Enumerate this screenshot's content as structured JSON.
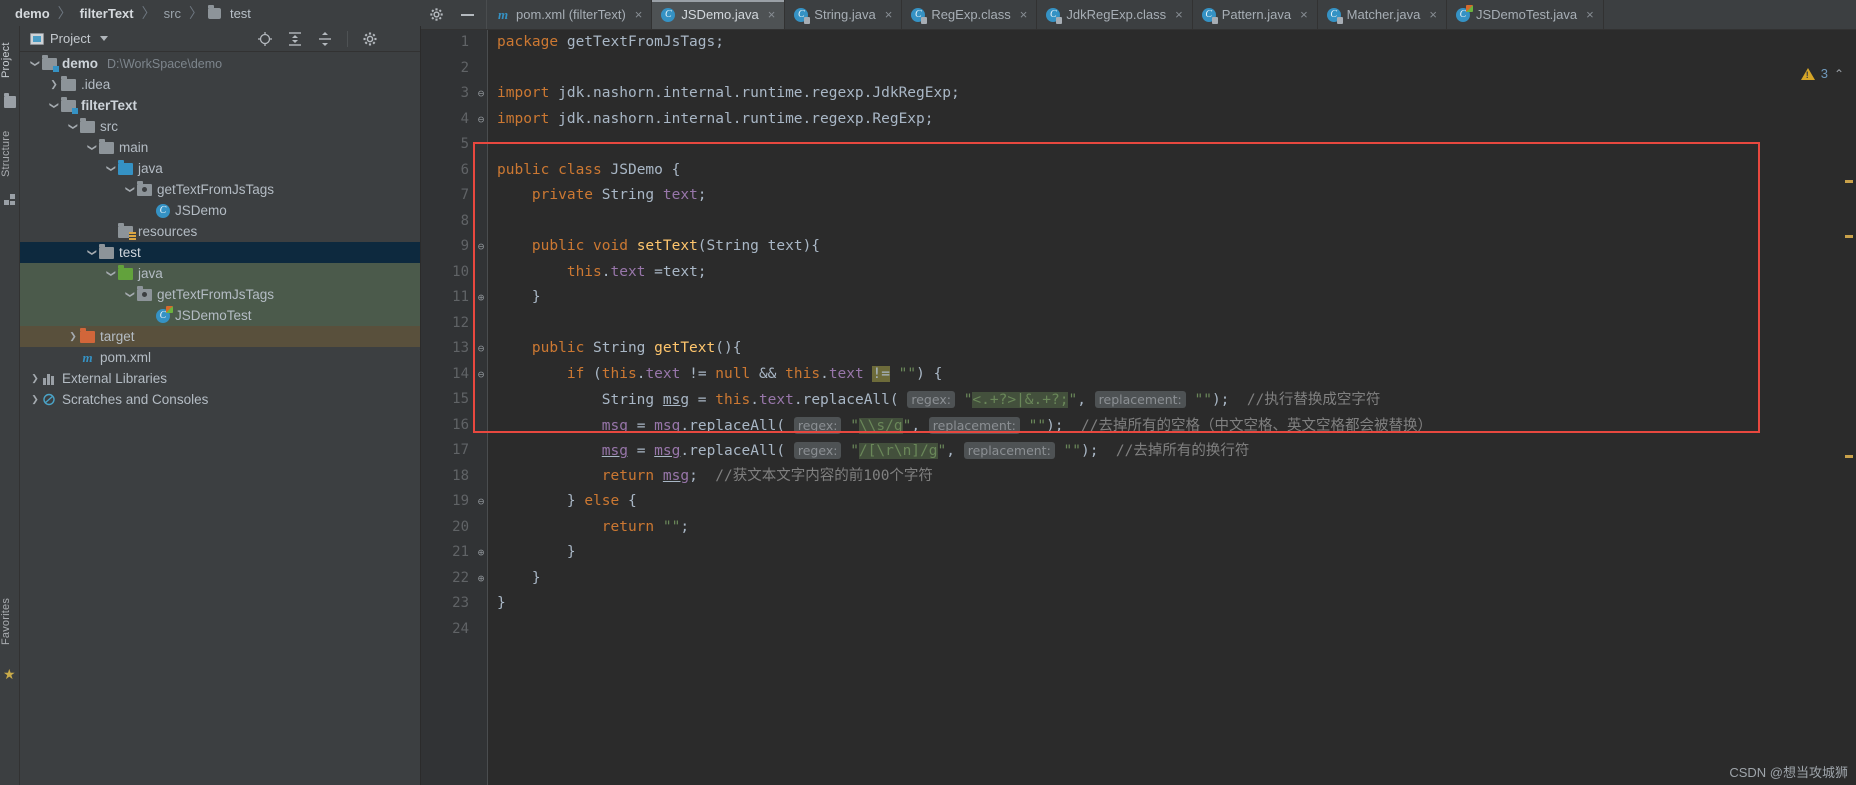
{
  "breadcrumb": {
    "items": [
      {
        "label": "demo",
        "style": "bold"
      },
      {
        "label": "filterText",
        "style": "bold"
      },
      {
        "label": "src",
        "style": "dim"
      },
      {
        "label": "test",
        "style": "folder"
      }
    ],
    "separator": "〉"
  },
  "left_strip": {
    "project_label": "Project",
    "structure_label": "Structure",
    "favorites_label": "Favorites"
  },
  "project_panel": {
    "title": "Project",
    "tools": [
      "locate-icon",
      "expand-all-icon",
      "collapse-all-icon",
      "settings-icon",
      "hide-icon"
    ],
    "tree": [
      {
        "indent": 0,
        "chev": "down",
        "icon": "module-folder",
        "label": "demo",
        "bold": true,
        "path": "D:\\WorkSpace\\demo",
        "bg": "none"
      },
      {
        "indent": 1,
        "chev": "right",
        "icon": "folder-grey",
        "label": ".idea",
        "bold": false,
        "path": "",
        "bg": "none"
      },
      {
        "indent": 1,
        "chev": "down",
        "icon": "module-folder",
        "label": "filterText",
        "bold": true,
        "path": "",
        "bg": "none"
      },
      {
        "indent": 2,
        "chev": "down",
        "icon": "folder-grey",
        "label": "src",
        "bold": false,
        "path": "",
        "bg": "none"
      },
      {
        "indent": 3,
        "chev": "down",
        "icon": "folder-grey",
        "label": "main",
        "bold": false,
        "path": "",
        "bg": "none"
      },
      {
        "indent": 4,
        "chev": "down",
        "icon": "folder-blue",
        "label": "java",
        "bold": false,
        "path": "",
        "bg": "none"
      },
      {
        "indent": 5,
        "chev": "down",
        "icon": "package",
        "label": "getTextFromJsTags",
        "bold": false,
        "path": "",
        "bg": "none"
      },
      {
        "indent": 6,
        "chev": "none",
        "icon": "class",
        "label": "JSDemo",
        "bold": false,
        "path": "",
        "bg": "none"
      },
      {
        "indent": 4,
        "chev": "none",
        "icon": "resources",
        "label": "resources",
        "bold": false,
        "path": "",
        "bg": "none"
      },
      {
        "indent": 3,
        "chev": "down",
        "icon": "folder-grey",
        "label": "test",
        "bold": false,
        "path": "",
        "bg": "selected"
      },
      {
        "indent": 4,
        "chev": "down",
        "icon": "folder-green",
        "label": "java",
        "bold": false,
        "path": "",
        "bg": "green"
      },
      {
        "indent": 5,
        "chev": "down",
        "icon": "package",
        "label": "getTextFromJsTags",
        "bold": false,
        "path": "",
        "bg": "green"
      },
      {
        "indent": 6,
        "chev": "none",
        "icon": "test-class",
        "label": "JSDemoTest",
        "bold": false,
        "path": "",
        "bg": "green"
      },
      {
        "indent": 2,
        "chev": "right",
        "icon": "folder-orange",
        "label": "target",
        "bold": false,
        "path": "",
        "bg": "brown"
      },
      {
        "indent": 2,
        "chev": "none",
        "icon": "maven",
        "label": "pom.xml",
        "bold": false,
        "path": "",
        "bg": "none"
      },
      {
        "indent": 0,
        "chev": "right",
        "icon": "library",
        "label": "External Libraries",
        "bold": false,
        "path": "",
        "bg": "none"
      },
      {
        "indent": 0,
        "chev": "right",
        "icon": "scratch",
        "label": "Scratches and Consoles",
        "bold": false,
        "path": "",
        "bg": "none"
      }
    ]
  },
  "editor": {
    "left_tools": [
      "settings-gear-icon",
      "hide-panel-icon"
    ],
    "tabs": [
      {
        "label": "pom.xml (filterText)",
        "icon": "maven-icon",
        "active": false,
        "closable": true
      },
      {
        "label": "JSDemo.java",
        "icon": "java-class-icon",
        "active": true,
        "closable": true
      },
      {
        "label": "String.java",
        "icon": "java-class-locked-icon",
        "active": false,
        "closable": true
      },
      {
        "label": "RegExp.class",
        "icon": "java-class-locked-icon",
        "active": false,
        "closable": true
      },
      {
        "label": "JdkRegExp.class",
        "icon": "java-class-locked-icon",
        "active": false,
        "closable": true
      },
      {
        "label": "Pattern.java",
        "icon": "java-class-locked-icon",
        "active": false,
        "closable": true
      },
      {
        "label": "Matcher.java",
        "icon": "java-class-locked-icon",
        "active": false,
        "closable": true
      },
      {
        "label": "JSDemoTest.java",
        "icon": "java-test-class-icon",
        "active": false,
        "closable": true
      }
    ],
    "inspection": {
      "warning_count": "3",
      "collapse_label": "⌃"
    },
    "line_numbers": [
      "1",
      "2",
      "3",
      "4",
      "5",
      "6",
      "7",
      "8",
      "9",
      "10",
      "11",
      "12",
      "13",
      "14",
      "15",
      "16",
      "17",
      "18",
      "19",
      "20",
      "21",
      "22",
      "23",
      "24"
    ],
    "code_lines": [
      {
        "n": "1",
        "fold": "",
        "tokens": [
          {
            "t": "package ",
            "c": "kw"
          },
          {
            "t": "getTextFromJsTags;",
            "c": "pln"
          }
        ]
      },
      {
        "n": "2",
        "fold": "",
        "tokens": []
      },
      {
        "n": "3",
        "fold": "⊖",
        "tokens": [
          {
            "t": "import ",
            "c": "kw"
          },
          {
            "t": "jdk.nashorn.internal.runtime.regexp.JdkRegExp;",
            "c": "pln"
          }
        ]
      },
      {
        "n": "4",
        "fold": "⊖",
        "tokens": [
          {
            "t": "import ",
            "c": "kw"
          },
          {
            "t": "jdk.nashorn.internal.runtime.regexp.RegExp;",
            "c": "pln"
          }
        ]
      },
      {
        "n": "5",
        "fold": "",
        "tokens": []
      },
      {
        "n": "6",
        "fold": "",
        "tokens": [
          {
            "t": "public class ",
            "c": "kw"
          },
          {
            "t": "JSDemo ",
            "c": "cls"
          },
          {
            "t": "{",
            "c": "pln"
          }
        ]
      },
      {
        "n": "7",
        "fold": "",
        "tokens": [
          {
            "t": "    private ",
            "c": "kw"
          },
          {
            "t": "String ",
            "c": "cls"
          },
          {
            "t": "text",
            "c": "fld"
          },
          {
            "t": ";",
            "c": "pln"
          }
        ]
      },
      {
        "n": "8",
        "fold": "",
        "tokens": []
      },
      {
        "n": "9",
        "fold": "⊖",
        "tokens": [
          {
            "t": "    public void ",
            "c": "kw"
          },
          {
            "t": "setText",
            "c": "mth"
          },
          {
            "t": "(",
            "c": "pln"
          },
          {
            "t": "String",
            "c": "cls"
          },
          {
            "t": " text){",
            "c": "pln"
          }
        ]
      },
      {
        "n": "10",
        "fold": "",
        "tokens": [
          {
            "t": "        this",
            "c": "kw"
          },
          {
            "t": ".",
            "c": "pln"
          },
          {
            "t": "text ",
            "c": "fld"
          },
          {
            "t": "=text;",
            "c": "pln"
          }
        ]
      },
      {
        "n": "11",
        "fold": "⊕",
        "tokens": [
          {
            "t": "    }",
            "c": "pln"
          }
        ]
      },
      {
        "n": "12",
        "fold": "",
        "tokens": []
      },
      {
        "n": "13",
        "fold": "⊖",
        "tokens": [
          {
            "t": "    public ",
            "c": "kw"
          },
          {
            "t": "String ",
            "c": "cls"
          },
          {
            "t": "getText",
            "c": "mth"
          },
          {
            "t": "(){",
            "c": "pln"
          }
        ]
      },
      {
        "n": "14",
        "fold": "⊖",
        "tokens": [
          {
            "t": "        ",
            "c": "pln"
          },
          {
            "t": "if ",
            "c": "kw"
          },
          {
            "t": "(",
            "c": "pln"
          },
          {
            "t": "this",
            "c": "kw"
          },
          {
            "t": ".",
            "c": "pln"
          },
          {
            "t": "text ",
            "c": "fld"
          },
          {
            "t": "!= ",
            "c": "pln"
          },
          {
            "t": "null ",
            "c": "kw"
          },
          {
            "t": "&& ",
            "c": "pln"
          },
          {
            "t": "this",
            "c": "kw"
          },
          {
            "t": ".",
            "c": "pln"
          },
          {
            "t": "text ",
            "c": "fld"
          },
          {
            "t": "!=",
            "c": "warn"
          },
          {
            "t": " ",
            "c": "pln"
          },
          {
            "t": "\"\"",
            "c": "str"
          },
          {
            "t": ") {",
            "c": "pln"
          }
        ]
      },
      {
        "n": "15",
        "fold": "",
        "tokens": []
      },
      {
        "n": "16",
        "fold": "",
        "tokens": []
      },
      {
        "n": "17",
        "fold": "",
        "tokens": []
      },
      {
        "n": "18",
        "fold": "",
        "tokens": []
      },
      {
        "n": "19",
        "fold": "⊖",
        "tokens": [
          {
            "t": "        } ",
            "c": "pln"
          },
          {
            "t": "else ",
            "c": "kw"
          },
          {
            "t": "{",
            "c": "pln"
          }
        ]
      },
      {
        "n": "20",
        "fold": "",
        "tokens": [
          {
            "t": "            ",
            "c": "pln"
          },
          {
            "t": "return ",
            "c": "kw"
          },
          {
            "t": "\"\"",
            "c": "str"
          },
          {
            "t": ";",
            "c": "pln"
          }
        ]
      },
      {
        "n": "21",
        "fold": "⊕",
        "tokens": [
          {
            "t": "        }",
            "c": "pln"
          }
        ]
      },
      {
        "n": "22",
        "fold": "⊕",
        "tokens": [
          {
            "t": "    }",
            "c": "pln"
          }
        ]
      },
      {
        "n": "23",
        "fold": "",
        "tokens": [
          {
            "t": "}",
            "c": "pln"
          }
        ]
      },
      {
        "n": "24",
        "fold": "",
        "tokens": []
      }
    ],
    "line15": {
      "indent": "            ",
      "decl": "String ",
      "var": "msg",
      "assign": " = ",
      "recv": "this",
      "dot": ".",
      "field": "text",
      "dot2": ".",
      "method": "replaceAll",
      "open": "( ",
      "hint_regex": "regex:",
      "quote": "\"",
      "regex_value": "<.+?>|&.+?;",
      "comma": ", ",
      "hint_replacement": "replacement:",
      "replacement_value": "\"\"",
      "close": ");",
      "comment": "//执行替换成空字符"
    },
    "line16": {
      "indent": "            ",
      "var": "msg",
      "assign": " = ",
      "recv": "msg",
      "dot": ".",
      "method": "replaceAll",
      "open": "( ",
      "hint_regex": "regex:",
      "regex_value": "\\\\s/g",
      "comma": ", ",
      "hint_replacement": "replacement:",
      "replacement_value": "\"\"",
      "close": ");",
      "comment": "//去掉所有的空格（中文空格、英文空格都会被替换）"
    },
    "line17": {
      "indent": "            ",
      "var": "msg",
      "assign": " = ",
      "recv": "msg",
      "dot": ".",
      "method": "replaceAll",
      "open": "( ",
      "hint_regex": "regex:",
      "regex_value": "/[\\r\\n]/g",
      "comma": ", ",
      "hint_replacement": "replacement:",
      "replacement_value": "\"\"",
      "close": ");",
      "comment": "//去掉所有的换行符"
    },
    "line18": {
      "indent": "            ",
      "kw": "return ",
      "var": "msg",
      "semi": ";",
      "comment": "//获文本文字内容的前100个字符"
    }
  },
  "watermark": "CSDN @想当攻城狮"
}
